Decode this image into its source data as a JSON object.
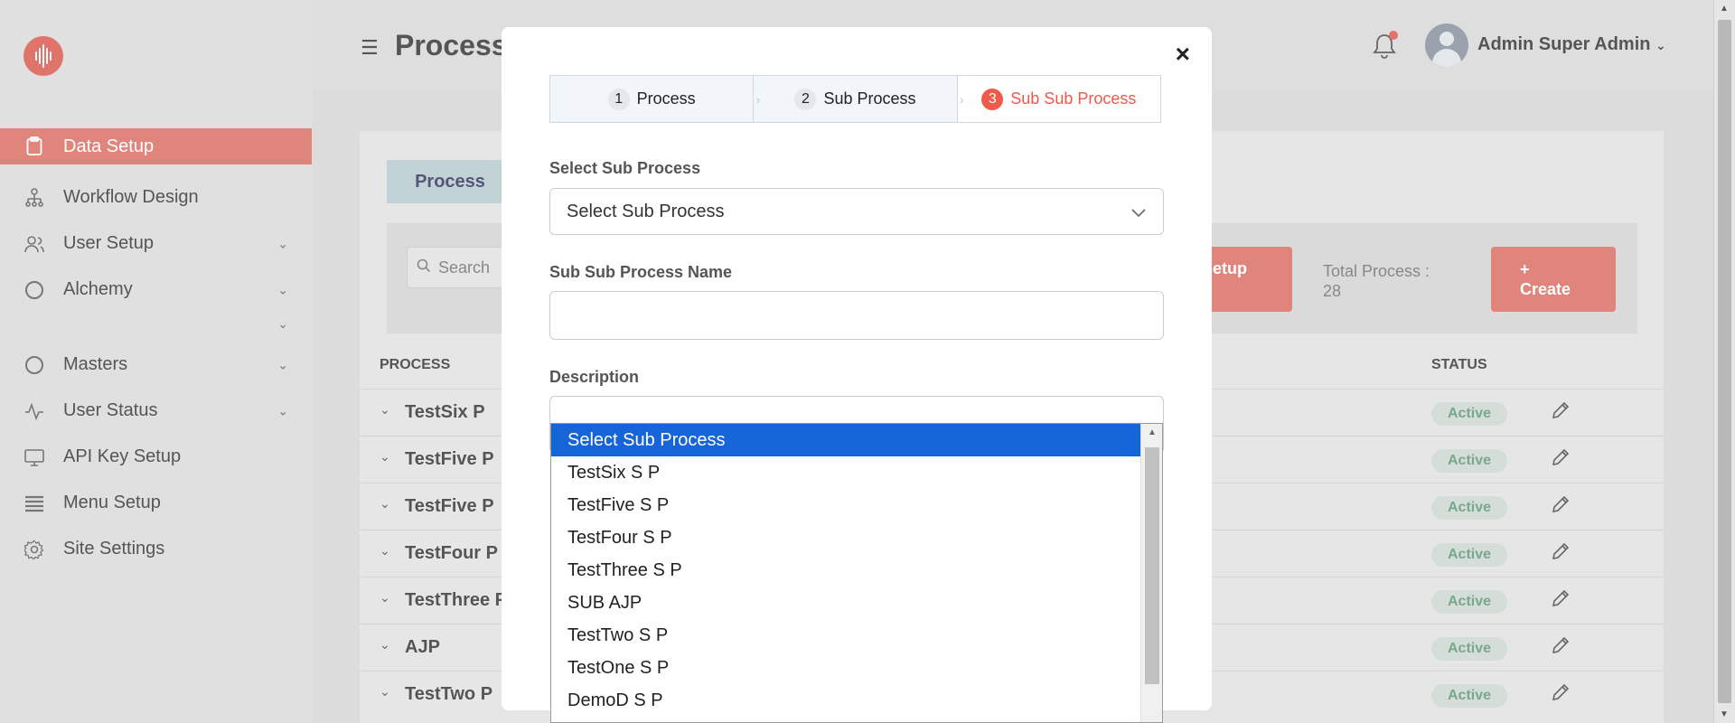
{
  "sidebar": {
    "items": [
      {
        "label": "Data Setup",
        "icon": "clipboard-icon",
        "active": true
      },
      {
        "label": "Workflow Design",
        "icon": "hierarchy-icon"
      },
      {
        "label": "User Setup",
        "icon": "users-icon",
        "has_chevron": true
      },
      {
        "label": "Alchemy",
        "icon": "circle-icon",
        "has_chevron": true
      },
      {
        "label": "Masters",
        "icon": "circle-icon",
        "has_chevron": true
      },
      {
        "label": "User Status",
        "icon": "activity-icon",
        "has_chevron": true
      },
      {
        "label": "API Key Setup",
        "icon": "monitor-icon"
      },
      {
        "label": "Menu Setup",
        "icon": "list-icon"
      },
      {
        "label": "Site Settings",
        "icon": "gear-icon"
      }
    ]
  },
  "header": {
    "title": "Process",
    "user_name": "Admin Super Admin"
  },
  "content": {
    "tab_label": "Process",
    "search_placeholder": "Search",
    "setup_button": "Setup",
    "total_label": "Total Process :",
    "total_value": "28",
    "create_button_plus": "+",
    "create_button": "Create",
    "col_process": "PROCESS",
    "col_status": "STATUS",
    "rows": [
      {
        "name": "TestSix P",
        "status": "Active"
      },
      {
        "name": "TestFive P",
        "status": "Active"
      },
      {
        "name": "TestFive P",
        "status": "Active"
      },
      {
        "name": "TestFour P",
        "status": "Active"
      },
      {
        "name": "TestThree P",
        "status": "Active"
      },
      {
        "name": "AJP",
        "status": "Active"
      },
      {
        "name": "TestTwo P",
        "status": "Active"
      }
    ]
  },
  "modal": {
    "close": "×",
    "steps": [
      {
        "num": "1",
        "label": "Process"
      },
      {
        "num": "2",
        "label": "Sub Process"
      },
      {
        "num": "3",
        "label": "Sub Sub Process"
      }
    ],
    "select_label": "Select Sub Process",
    "select_value": "Select Sub Process",
    "name_label": "Sub Sub Process Name",
    "description_label": "Description",
    "options": [
      "Select Sub Process",
      "TestSix S P",
      "TestFive S P",
      "TestFour S P",
      "TestThree S P",
      "SUB AJP",
      "TestTwo S P",
      "TestOne S P",
      "DemoD S P"
    ]
  },
  "colors": {
    "accent": "#f05a4a",
    "sidebar_active": "#e0857c",
    "selected_option": "#1565d8",
    "status_text": "#7aa88e"
  }
}
